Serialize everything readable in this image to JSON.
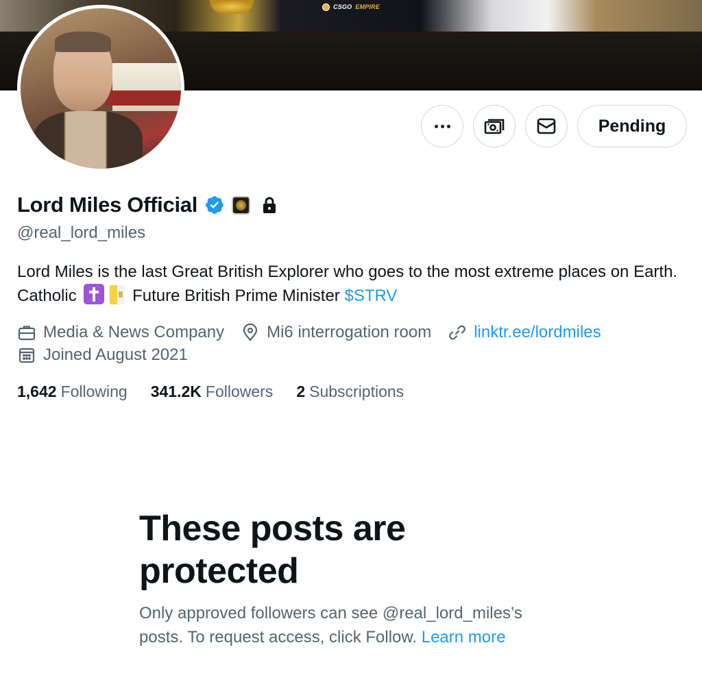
{
  "banner": {
    "logo_text": "CSGO",
    "logo_accent": "EMPIRE"
  },
  "actions": {
    "more_icon": "more-dots-icon",
    "subscribe_icon": "money-icon",
    "message_icon": "mail-icon",
    "pending_label": "Pending"
  },
  "profile": {
    "display_name": "Lord Miles Official",
    "handle": "@real_lord_miles",
    "badges": [
      "verified-badge-icon",
      "affiliate-badge-icon",
      "lock-icon"
    ],
    "bio": {
      "text_1": "Lord Miles is the last Great British Explorer who goes to the most extreme places on Earth. Catholic",
      "text_2": "Future British Prime Minister",
      "cashtag": "$STRV"
    },
    "meta": {
      "category": "Media & News Company",
      "location": "Mi6 interrogation room",
      "website": "linktr.ee/lordmiles",
      "joined": "Joined August 2021"
    },
    "stats": {
      "following_count": "1,642",
      "following_label": "Following",
      "followers_count": "341.2K",
      "followers_label": "Followers",
      "subscriptions_count": "2",
      "subscriptions_label": "Subscriptions"
    }
  },
  "protected": {
    "title": "These posts are protected",
    "text": "Only approved followers can see @real_lord_miles’s posts. To request access, click Follow.",
    "learn_more": "Learn more"
  },
  "colors": {
    "link": "#1d9bf0",
    "secondary_text": "#536471",
    "primary_text": "#0f1419",
    "verified": "#1d9bf0"
  }
}
